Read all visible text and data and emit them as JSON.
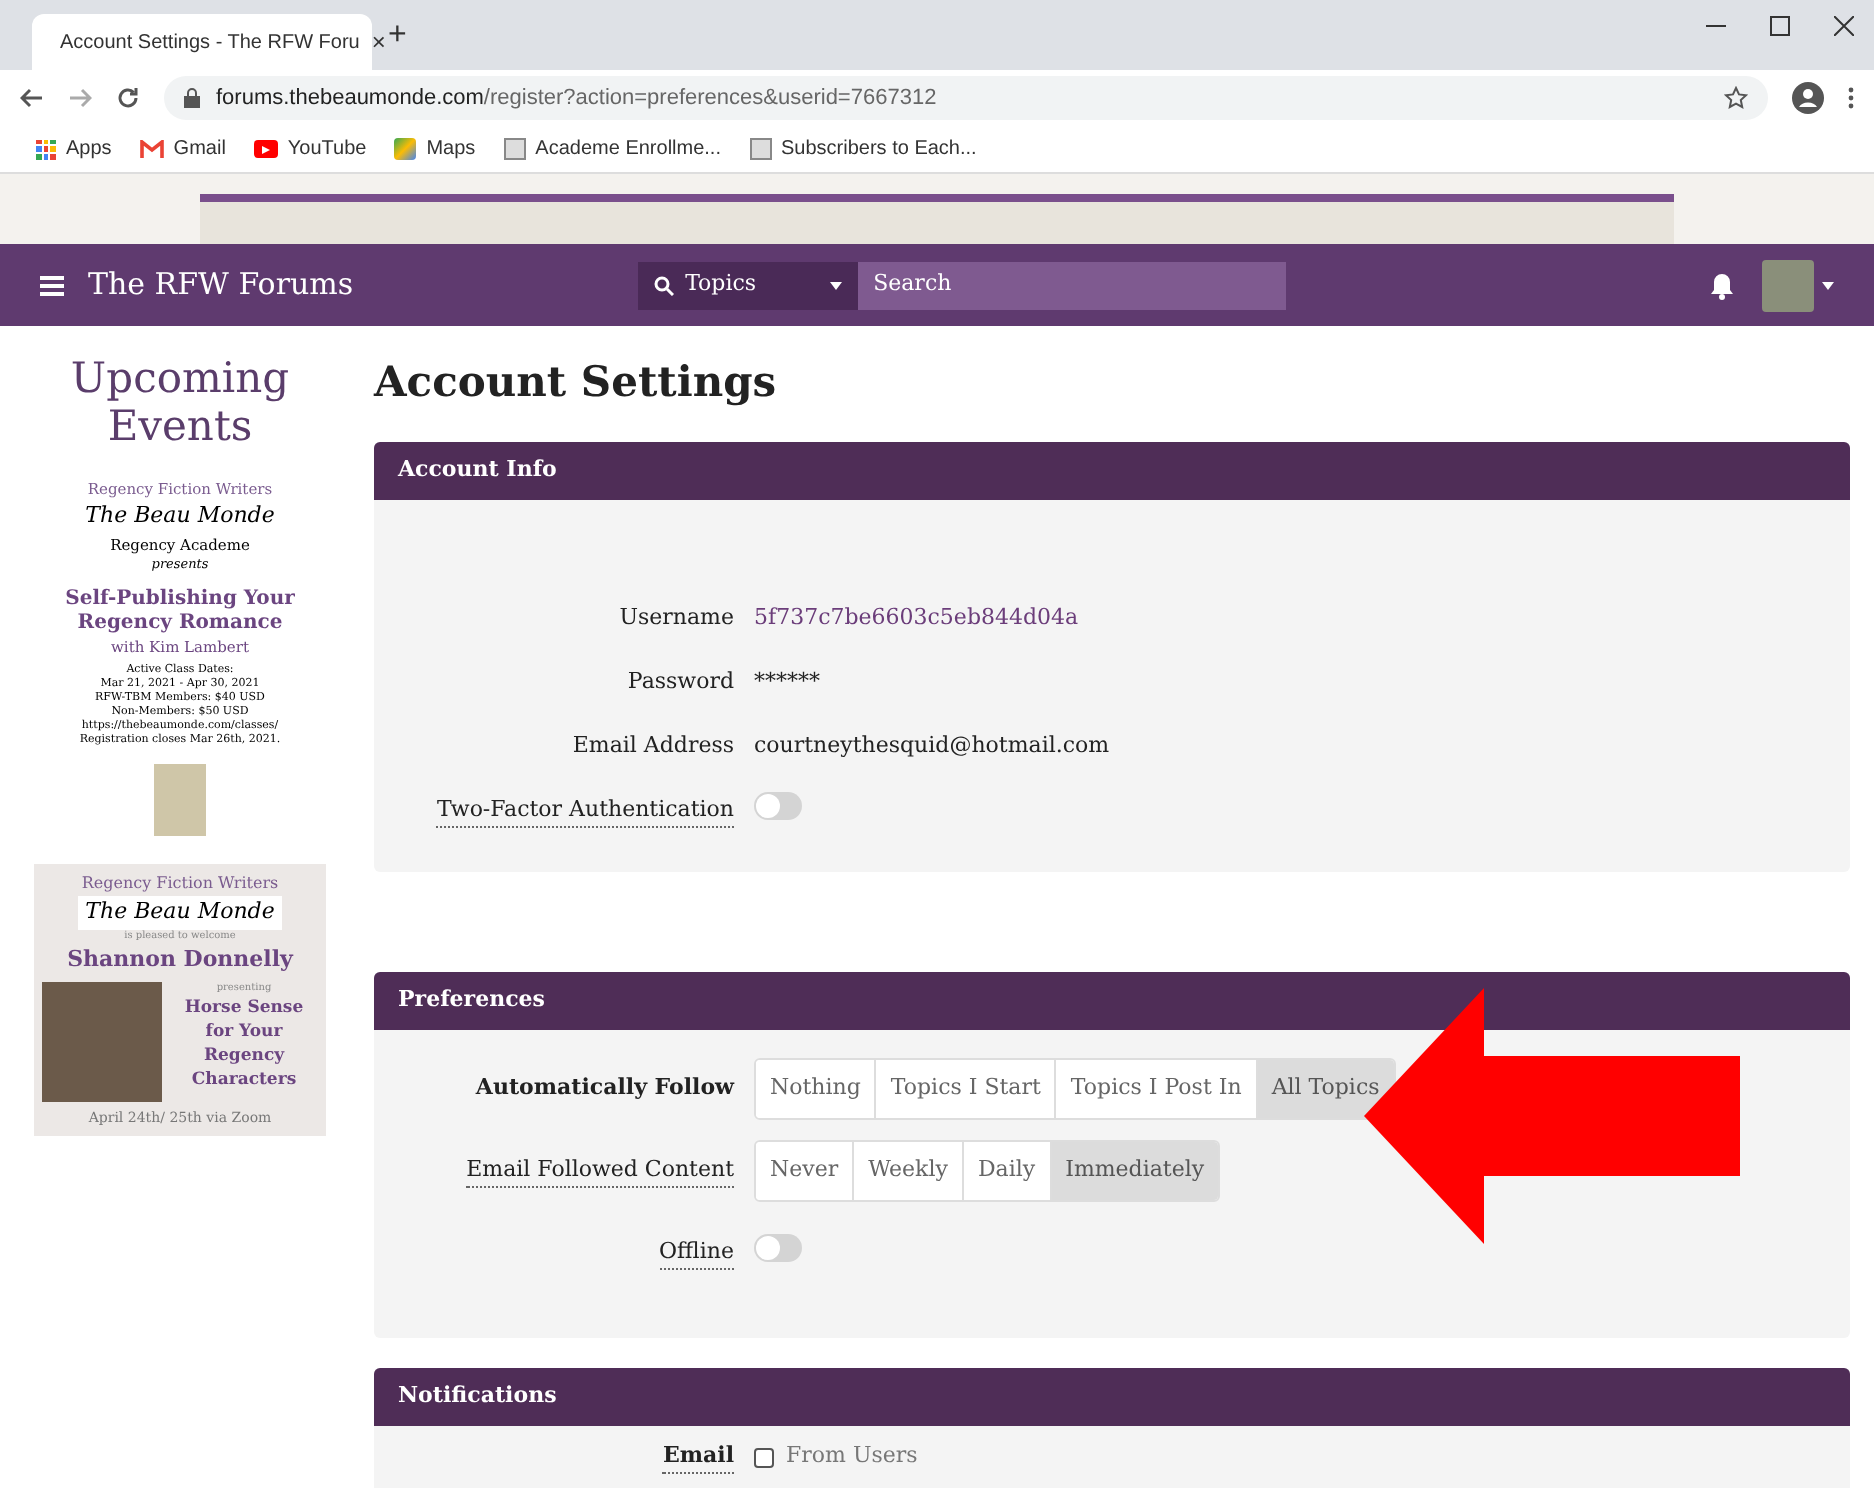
{
  "browser": {
    "tab_title": "Account Settings - The RFW Foru",
    "tab_close": "×",
    "new_tab": "+",
    "url_host": "forums.thebeaumonde.com",
    "url_path": "/register?action=preferences&userid=7667312",
    "bookmarks": [
      {
        "kind": "apps",
        "label": "Apps"
      },
      {
        "kind": "gmail",
        "label": "Gmail"
      },
      {
        "kind": "youtube",
        "label": "YouTube"
      },
      {
        "kind": "maps",
        "label": "Maps"
      },
      {
        "kind": "page",
        "label": "Academe Enrollme..."
      },
      {
        "kind": "page",
        "label": "Subscribers to Each..."
      }
    ]
  },
  "navbar": {
    "title": "The RFW Forums",
    "search_scope": "Topics",
    "search_placeholder": "Search"
  },
  "sidebar": {
    "heading": "Upcoming Events",
    "event_1": {
      "org": "Regency Fiction Writers",
      "brand": "The Beau Monde",
      "sub": "Regency Academe",
      "presents": "presents",
      "title": "Self-Publishing Your Regency Romance",
      "with": "with Kim Lambert",
      "details": [
        "Active Class Dates:",
        "Mar 21, 2021 - Apr 30, 2021",
        "RFW-TBM Members: $40 USD",
        "Non-Members: $50 USD",
        "https://thebeaumonde.com/classes/",
        "Registration closes Mar 26th, 2021."
      ]
    },
    "event_2": {
      "org": "Regency Fiction Writers",
      "brand": "The Beau Monde",
      "welcome": "is pleased to welcome",
      "speaker": "Shannon Donnelly",
      "presenting": "presenting",
      "title": "Horse Sense for Your Regency Characters",
      "date": "April 24th/ 25th via Zoom"
    }
  },
  "page_title": "Account Settings",
  "sections": [
    {
      "title": "Account Info",
      "rows": [
        {
          "kind": "text",
          "label": "Username",
          "value": "5f737c7be6603c5eb844d04a",
          "link": true
        },
        {
          "kind": "text",
          "label": "Password",
          "value": "******",
          "link": false
        },
        {
          "kind": "text",
          "label": "Email Address",
          "value": "courtneythesquid@hotmail.com",
          "link": false
        },
        {
          "kind": "toggle",
          "label": "Two-Factor Authentication",
          "on": false
        }
      ]
    },
    {
      "title": "Preferences",
      "rows": [
        {
          "kind": "segmented",
          "label": "Automatically Follow",
          "options": [
            {
              "label": "Nothing",
              "selected": false
            },
            {
              "label": "Topics I Start",
              "selected": false
            },
            {
              "label": "Topics I Post In",
              "selected": false
            },
            {
              "label": "All Topics",
              "selected": true
            }
          ]
        },
        {
          "kind": "segmented",
          "label": "Email Followed Content",
          "options": [
            {
              "label": "Never",
              "selected": false
            },
            {
              "label": "Weekly",
              "selected": false
            },
            {
              "label": "Daily",
              "selected": false
            },
            {
              "label": "Immediately",
              "selected": true
            }
          ]
        },
        {
          "kind": "toggle",
          "label": "Offline",
          "on": false
        }
      ]
    },
    {
      "title": "Notifications",
      "rows": [
        {
          "kind": "checkbox",
          "label": "Email",
          "option": "From Users",
          "checked": false
        }
      ]
    }
  ]
}
